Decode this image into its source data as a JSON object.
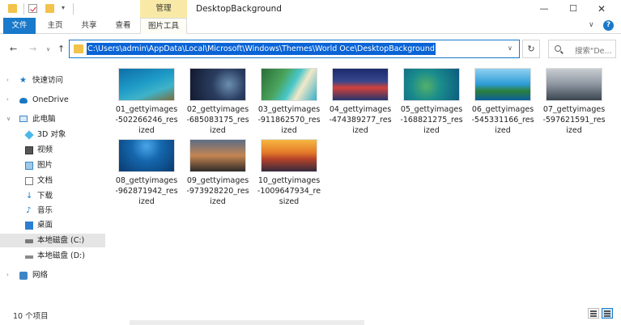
{
  "window": {
    "title": "DesktopBackground",
    "context_tab": "管理",
    "controls": {
      "minimize": "—",
      "maximize": "☐",
      "close": "✕"
    }
  },
  "ribbon": {
    "tabs": [
      "文件",
      "主页",
      "共享",
      "查看",
      "图片工具"
    ],
    "active_tab_color": "#1979ca",
    "help": "?"
  },
  "address": {
    "path": "C:\\Users\\admin\\AppData\\Local\\Microsoft\\Windows\\Themes\\World Oce\\DesktopBackground",
    "search_placeholder": "搜索\"De..."
  },
  "nav": {
    "back": "←",
    "forward": "→",
    "up": "↑",
    "refresh": "↻",
    "dropdown": "∨"
  },
  "sidebar": {
    "items": [
      {
        "label": "快速访问",
        "icon": "quick-access-star-icon",
        "glyph": "★"
      },
      {
        "label": "OneDrive",
        "icon": "onedrive-cloud-icon"
      },
      {
        "label": "此电脑",
        "icon": "this-pc-icon"
      },
      {
        "label": "3D 对象",
        "icon": "3d-objects-icon"
      },
      {
        "label": "视频",
        "icon": "videos-icon"
      },
      {
        "label": "图片",
        "icon": "pictures-icon"
      },
      {
        "label": "文档",
        "icon": "documents-icon"
      },
      {
        "label": "下载",
        "icon": "downloads-icon",
        "glyph": "↓"
      },
      {
        "label": "音乐",
        "icon": "music-icon",
        "glyph": "♪"
      },
      {
        "label": "桌面",
        "icon": "desktop-icon"
      },
      {
        "label": "本地磁盘 (C:)",
        "icon": "drive-c-icon",
        "selected": true
      },
      {
        "label": "本地磁盘 (D:)",
        "icon": "drive-d-icon"
      },
      {
        "label": "网络",
        "icon": "network-icon"
      }
    ]
  },
  "files": [
    {
      "name": "01_gettyimages-502266246_resized",
      "lines": [
        "01_gettyimages",
        "-502266246_res",
        "ized"
      ]
    },
    {
      "name": "02_gettyimages-685083175_resized",
      "lines": [
        "02_gettyimages",
        "-685083175_res",
        "ized"
      ]
    },
    {
      "name": "03_gettyimages-911862570_resized",
      "lines": [
        "03_gettyimages",
        "-911862570_res",
        "ized"
      ]
    },
    {
      "name": "04_gettyimages-474389277_resized",
      "lines": [
        "04_gettyimages",
        "-474389277_res",
        "ized"
      ]
    },
    {
      "name": "05_gettyimages-168821275_resized",
      "lines": [
        "05_gettyimages",
        "-168821275_res",
        "ized"
      ]
    },
    {
      "name": "06_gettyimages-545331166_resized",
      "lines": [
        "06_gettyimages",
        "-545331166_res",
        "ized"
      ]
    },
    {
      "name": "07_gettyimages-597621591_resized",
      "lines": [
        "07_gettyimages",
        "-597621591_res",
        "ized"
      ]
    },
    {
      "name": "08_gettyimages-962871942_resized",
      "lines": [
        "08_gettyimages",
        "-962871942_res",
        "ized"
      ]
    },
    {
      "name": "09_gettyimages-973928220_resized",
      "lines": [
        "09_gettyimages",
        "-973928220_res",
        "ized"
      ]
    },
    {
      "name": "10_gettyimages-1009647934_resized",
      "lines": [
        "10_gettyimages",
        "-1009647934_re",
        "sized"
      ]
    }
  ],
  "status": {
    "item_count": "10 个项目"
  }
}
